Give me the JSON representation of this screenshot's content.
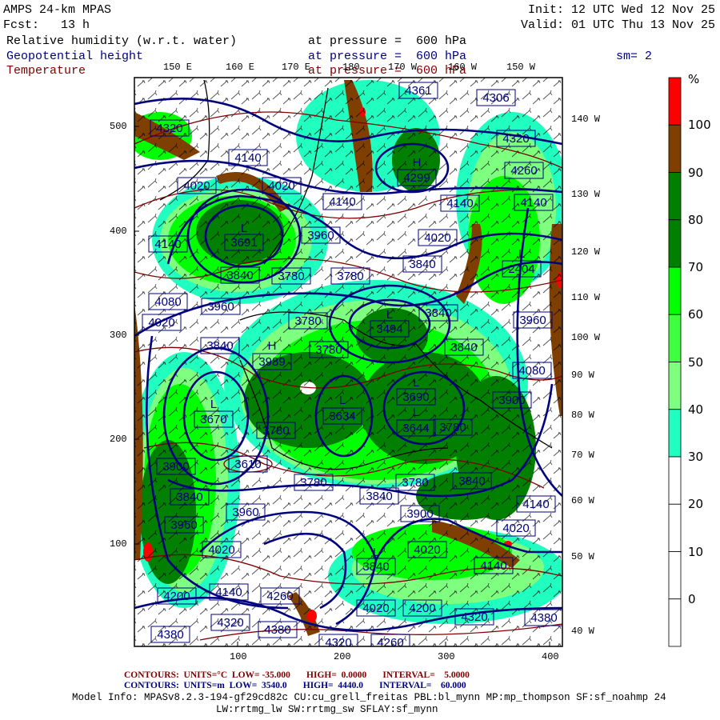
{
  "header": {
    "model": "AMPS 24-km MPAS",
    "forecast": "Fcst:   13 h",
    "init": "Init: 12 UTC Wed 12 Nov 25",
    "valid": "Valid: 01 UTC Thu 13 Nov 25",
    "fields": [
      {
        "name": "Relative humidity (w.r.t. water)",
        "level": "at pressure =  600 hPa",
        "color": "#000000"
      },
      {
        "name": "Geopotential height",
        "level": "at pressure =  600 hPa",
        "color": "#00007f"
      },
      {
        "name": "Temperature",
        "level": "at pressure =  600 hPa",
        "color": "#7f0000"
      }
    ],
    "smoothing": "sm= 2"
  },
  "axes": {
    "top_lon": [
      "150 E",
      "160 E",
      "170 E",
      "180",
      "170 W",
      "160 W",
      "150 W"
    ],
    "right_lon": [
      "140 W",
      "130 W",
      "120 W",
      "110 W",
      "100 W",
      "90 W",
      "80 W",
      "70 W",
      "60 W",
      "50 W",
      "40 W"
    ],
    "x_ticks": [
      "100",
      "200",
      "300",
      "400"
    ],
    "y_ticks": [
      "500",
      "400",
      "300",
      "200",
      "100"
    ]
  },
  "colorbar": {
    "unit": "%",
    "labels": [
      "100",
      "90",
      "80",
      "70",
      "60",
      "50",
      "40",
      "30",
      "20",
      "10",
      "0"
    ],
    "colors": [
      "#ff0000",
      "#7f3f00",
      "#007f00",
      "#007f00",
      "#00ff00",
      "#3fff3f",
      "#7fff7f",
      "#20ffc0",
      "#ffffff",
      "#ffffff",
      "#ffffff",
      "#ffffff"
    ]
  },
  "contour_labels": [
    "4361",
    "4306",
    "4320",
    "4140",
    "4020",
    "4020",
    "H",
    "4299",
    "4320",
    "4260",
    "4140",
    "4140",
    "4140",
    "L",
    "3691",
    "3960",
    "4020",
    "4140",
    "3840",
    "3780",
    "3780",
    "3840",
    "L",
    "2404",
    "4080",
    "3960",
    "4020",
    "3780",
    "L",
    "3494",
    "3840",
    "3960",
    "3840",
    "H",
    "3989",
    "3780",
    "3840",
    "4080",
    "L",
    "3670",
    "3780",
    "L",
    "3634",
    "L",
    "3690",
    "L",
    "3644",
    "3780",
    "3900",
    "3900",
    "3610",
    "3780",
    "3780",
    "3840",
    "3840",
    "3960",
    "3840",
    "3900",
    "4140",
    "3960",
    "4020",
    "4020",
    "L",
    "3840",
    "4020",
    "4140",
    "4200",
    "4140",
    "4260",
    "4020",
    "4200",
    "4320",
    "4380",
    "4320",
    "4380",
    "4380",
    "4320",
    "4260"
  ],
  "footer": {
    "temp_contours": "CONTOURS:  UNITS=°C  LOW= -35.000       HIGH=  0.0000       INTERVAL=    5.0000",
    "height_contours": "CONTOURS:  UNITS=m  LOW=  3540.0       HIGH=  4440.0       INTERVAL=    60.000",
    "model_info": "Model Info: MPASv8.2.3-194-gf29cd82c CU:cu_grell_freitas PBL:bl_mynn MP:mp_thompson SF:sf_noahmp 24",
    "model_info2": "LW:rrtmg_lw SW:rrtmg_sw SFLAY:sf_mynn"
  }
}
